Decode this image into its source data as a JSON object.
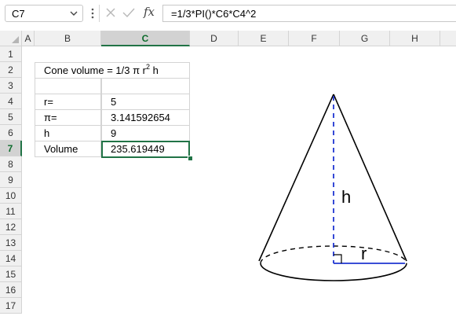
{
  "formula_bar": {
    "name_box": "C7",
    "fx_label": "fx",
    "formula": "=1/3*PI()*C6*C4^2"
  },
  "columns": [
    "A",
    "B",
    "C",
    "D",
    "E",
    "F",
    "G",
    "H"
  ],
  "selected_column": "C",
  "rows": [
    "1",
    "2",
    "3",
    "4",
    "5",
    "6",
    "7",
    "8",
    "9",
    "10",
    "11",
    "12",
    "13",
    "14",
    "15",
    "16",
    "17"
  ],
  "selected_row": "7",
  "table": {
    "title_prefix": "Cone volume = 1/3 π r",
    "title_exp": "2",
    "title_suffix": " h",
    "rows": [
      {
        "label": "r=",
        "value": "5"
      },
      {
        "label": "π=",
        "value": "3.141592654"
      },
      {
        "label": "h",
        "value": "9"
      },
      {
        "label": "Volume",
        "value": "235.619449"
      }
    ]
  },
  "diagram": {
    "height_label": "h",
    "radius_label": "r",
    "line_color": "#000000",
    "accent_color": "#1f35d1"
  },
  "colors": {
    "excel_green": "#217346",
    "header_bg": "#f0f0f0",
    "gridline": "#d4d4d4"
  }
}
